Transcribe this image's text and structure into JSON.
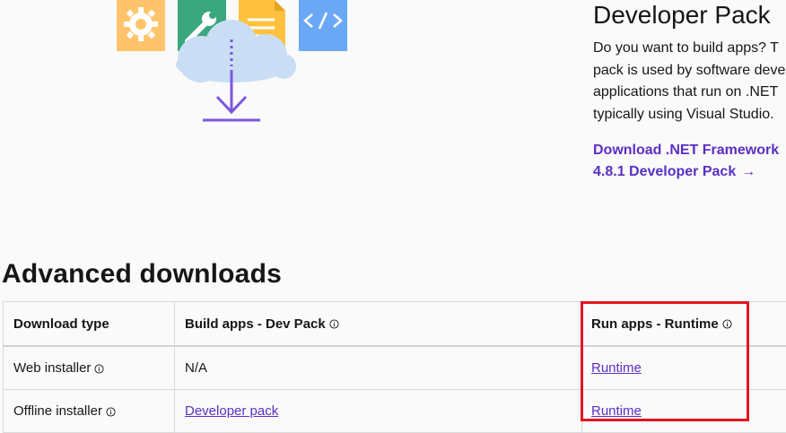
{
  "developer_pack": {
    "title": "Developer Pack",
    "description_lines": [
      "Do you want to build apps? T",
      "pack is used by software deve",
      "applications that run on .NET",
      "typically using Visual Studio."
    ],
    "link_line1": "Download .NET Framework",
    "link_line2": "4.8.1 Developer Pack",
    "link_arrow": "→"
  },
  "advanced": {
    "title": "Advanced downloads",
    "headers": [
      "Download type",
      "Build apps - Dev Pack",
      "Run apps - Runtime"
    ],
    "rows": [
      {
        "type": "Web installer",
        "build": "N/A",
        "run": "Runtime"
      },
      {
        "type": "Offline installer",
        "build": "Developer pack",
        "run": "Runtime"
      }
    ]
  },
  "colors": {
    "accent": "#5a2fc2",
    "highlight": "#e0161e",
    "gear_tile": "#ffc46b",
    "wrench_tile": "#3aa77f",
    "doc_tile": "#ffc13d",
    "code_tile": "#6aa8f5",
    "cloud": "#c9def5"
  }
}
